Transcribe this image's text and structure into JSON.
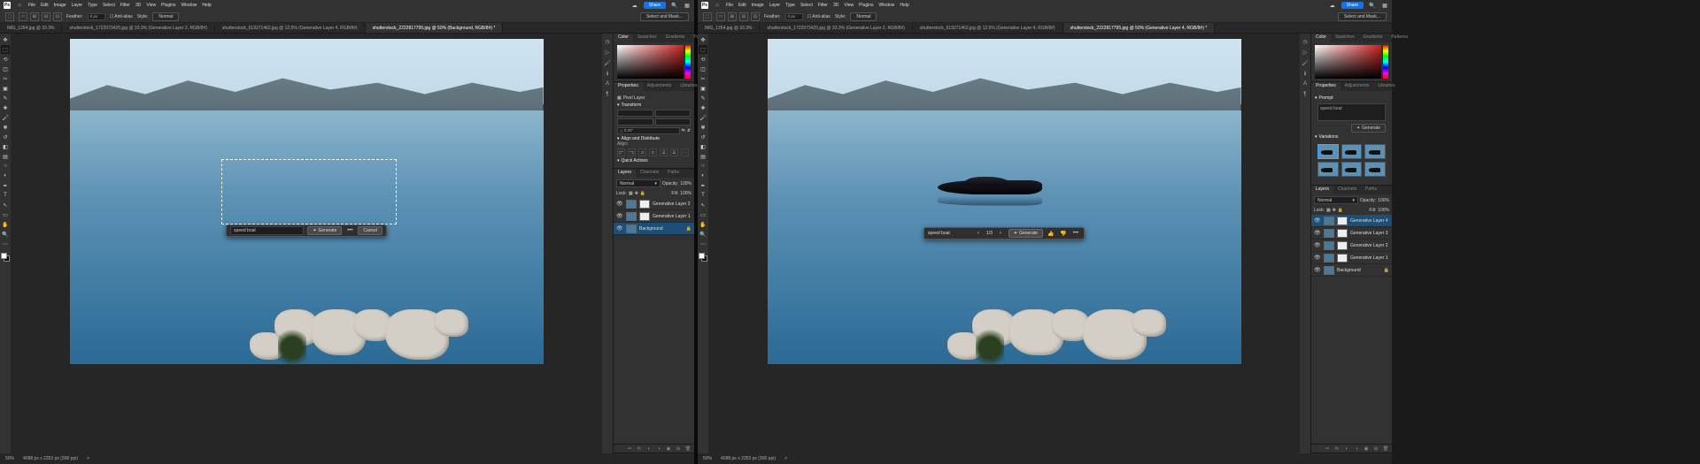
{
  "menu": [
    "File",
    "Edit",
    "Image",
    "Layer",
    "Type",
    "Select",
    "Filter",
    "3D",
    "View",
    "Plugins",
    "Window",
    "Help"
  ],
  "share": "Share",
  "optbar": {
    "feather_label": "Feather:",
    "feather_val": "0 px",
    "antialias": "Anti-alias",
    "style_label": "Style:",
    "style_val": "Normal",
    "selectmask": "Select and Mask..."
  },
  "tabs_left": [
    "IMG_1264.jpg @ 33.3%",
    "shutterstock_1722073425.jpg @ 33.3% (Generative Layer 2, RGB/8#)",
    "shutterstock_619271462.jpg @ 12.5% (Generative Layer 4, RGB/8#)"
  ],
  "active_tab_left": "shutterstock_2222817795.jpg @ 50% (Background, RGB/8#) *",
  "tabs_right": [
    "IMG_1264.jpg @ 33.3%",
    "shutterstock_1722073425.jpg @ 33.3% (Generative Layer 2, RGB/8#)",
    "shutterstock_619271462.jpg @ 12.5% (Generative Layer 4, RGB/8#)"
  ],
  "active_tab_right": "shutterstock_2222817795.jpg @ 50% (Generative Layer 4, RGB/8#) *",
  "status": {
    "zoom": "50%",
    "doc": "4088 px x 2353 px (300 ppi)",
    "arrow": ">"
  },
  "panel_tabs": {
    "color": "Color",
    "swatches": "Swatches",
    "gradients": "Gradients",
    "patterns": "Patterns",
    "props": "Properties",
    "adjust": "Adjustments",
    "libraries": "Libraries",
    "layers": "Layers",
    "channels": "Channels",
    "paths": "Paths"
  },
  "props": {
    "pixel_layer": "Pixel Layer",
    "transform": "Transform",
    "align": "Align and Distribute",
    "align_sub": "Align:",
    "quick": "Quick Actions"
  },
  "layers": {
    "mode": "Normal",
    "opacity_l": "Opacity:",
    "opacity_v": "100%",
    "lock": "Lock:",
    "fill_l": "Fill:",
    "fill_v": "100%",
    "rows_left": [
      {
        "name": "Generative Layer 2"
      },
      {
        "name": "Generative Layer 1"
      },
      {
        "name": "Background",
        "locked": true
      }
    ],
    "rows_right": [
      {
        "name": "Generative Layer 4"
      },
      {
        "name": "Generative Layer 3"
      },
      {
        "name": "Generative Layer 2"
      },
      {
        "name": "Generative Layer 1"
      },
      {
        "name": "Background",
        "locked": true
      }
    ]
  },
  "genfill": {
    "prompt_left": "speed boat",
    "generate": "Generate",
    "cancel": "Cancel",
    "more": "•••",
    "prompt_right": "speed boat",
    "nav": "1/3"
  },
  "right_props": {
    "prompt_hd": "Prompt",
    "prompt_val": "speed boat",
    "variations": "Variations",
    "generate": "Generate"
  }
}
